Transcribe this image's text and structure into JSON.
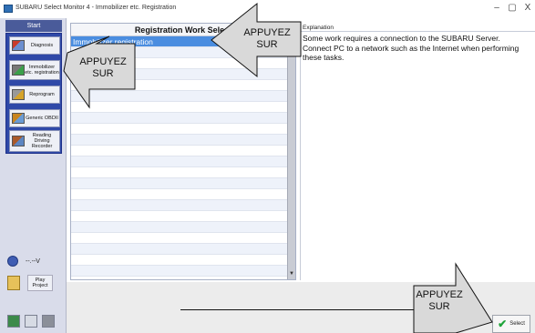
{
  "window": {
    "title": "SUBARU Select Monitor 4 - Immobilizer etc. Registration",
    "min_glyph": "–",
    "max_glyph": "▢",
    "close_glyph": "X"
  },
  "sidebar": {
    "start_label": "Start",
    "items": [
      {
        "label": "Diagnosis",
        "icon": "diagnosis-icon"
      },
      {
        "label": "Immobilizer etc. registration",
        "icon": "immobilizer-icon"
      },
      {
        "label": "Reprogram",
        "icon": "reprogram-icon"
      },
      {
        "label": "Generic OBDII",
        "icon": "obd-icon"
      },
      {
        "label": "Reading Driving Recorder",
        "icon": "recorder-icon"
      }
    ],
    "user_label": "--.--V",
    "play_label": "Play Project"
  },
  "list": {
    "header": "Registration Work Select",
    "selected_item": "Immobilizer registration"
  },
  "explanation": {
    "title": "Explanation",
    "text": "Some work requires a connection to the SUBARU Server. Connect PC to a network such as the Internet when performing these tasks."
  },
  "footer": {
    "select_label": "Select"
  },
  "callouts": {
    "top": "APPUYEZ SUR",
    "left": "APPUYEZ SUR",
    "bottom": "APPUYEZ SUR"
  }
}
